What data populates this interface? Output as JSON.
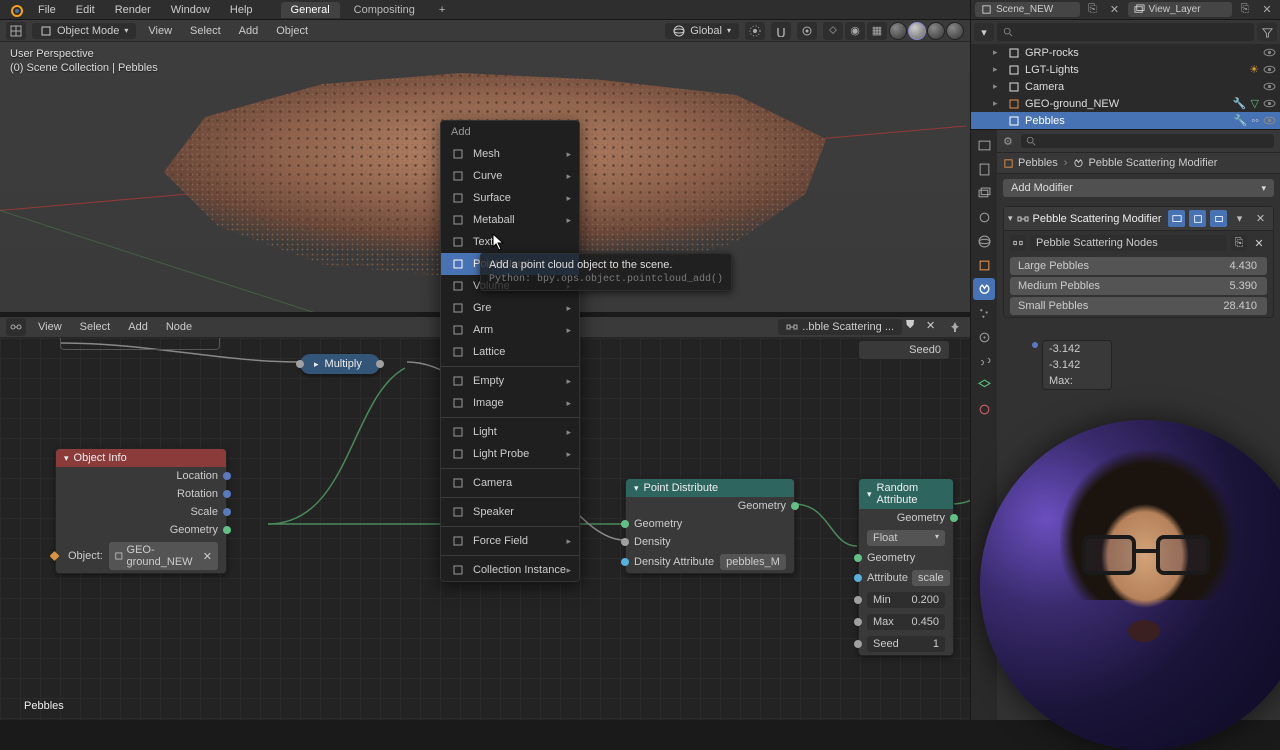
{
  "app": {
    "menus": [
      "File",
      "Edit",
      "Render",
      "Window",
      "Help"
    ],
    "tabs": {
      "general": "General",
      "compositing": "Compositing",
      "add": "+"
    },
    "scene_icon": "scene-icon",
    "scene": "Scene_NEW",
    "viewlayer_icon": "layer-icon",
    "viewlayer": "View_Layer"
  },
  "viewport_header": {
    "mode": "Object Mode",
    "menus": [
      "View",
      "Select",
      "Add",
      "Object"
    ],
    "orientation": "Global",
    "icon_dropdown": "chevron-down-icon"
  },
  "viewport": {
    "perspective": "User Perspective",
    "collection": "(0) Scene Collection | Pebbles",
    "active_object": "Pebbles"
  },
  "add_menu": {
    "title": "Add",
    "items": [
      {
        "icon": "mesh-icon",
        "label": "Mesh",
        "sub": true
      },
      {
        "icon": "curve-icon",
        "label": "Curve",
        "sub": true
      },
      {
        "icon": "surface-icon",
        "label": "Surface",
        "sub": true
      },
      {
        "icon": "metaball-icon",
        "label": "Metaball",
        "sub": true
      },
      {
        "icon": "text-icon",
        "label": "Text",
        "sub": false
      },
      {
        "icon": "pointcloud-icon",
        "label": "Point Cloud",
        "sub": false,
        "highlight": true
      },
      {
        "icon": "volume-icon",
        "label": "Volume",
        "sub": true
      },
      {
        "icon": "grease-pencil-icon",
        "label": "Gre",
        "sub": true,
        "cut": true
      },
      {
        "icon": "armature-icon",
        "label": "Arm",
        "sub": true,
        "cut": true
      },
      {
        "icon": "lattice-icon",
        "label": "Lattice",
        "sub": false
      },
      {
        "sep": true
      },
      {
        "icon": "empty-icon",
        "label": "Empty",
        "sub": true
      },
      {
        "icon": "image-icon",
        "label": "Image",
        "sub": true
      },
      {
        "sep": true
      },
      {
        "icon": "light-icon",
        "label": "Light",
        "sub": true
      },
      {
        "icon": "lightprobe-icon",
        "label": "Light Probe",
        "sub": true
      },
      {
        "sep": true
      },
      {
        "icon": "camera-icon",
        "label": "Camera",
        "sub": false
      },
      {
        "sep": true
      },
      {
        "icon": "speaker-icon",
        "label": "Speaker",
        "sub": false
      },
      {
        "sep": true
      },
      {
        "icon": "forcefield-icon",
        "label": "Force Field",
        "sub": true
      },
      {
        "sep": true
      },
      {
        "icon": "collection-icon",
        "label": "Collection Instance",
        "sub": true
      }
    ]
  },
  "tooltip": {
    "text": "Add a point cloud object to the scene.",
    "python": "Python: bpy.ops.object.pointcloud_add()"
  },
  "node_editor_header": {
    "menus": [
      "View",
      "Select",
      "Add",
      "Node"
    ],
    "nodegroup": "..bble Scattering ..."
  },
  "nodes": {
    "multiply": {
      "label": "Multiply"
    },
    "object_info": {
      "title": "Object Info",
      "out_location": "Location",
      "out_rotation": "Rotation",
      "out_scale": "Scale",
      "out_geometry": "Geometry",
      "object_label": "Object:",
      "object_value": "GEO-ground_NEW"
    },
    "point_distribute": {
      "title": "Point Distribute",
      "out_geometry": "Geometry",
      "in_geometry": "Geometry",
      "in_density": "Density",
      "in_density_attr": "Density Attribute",
      "density_attr_value": "pebbles_M"
    },
    "random_attribute": {
      "title": "Random Attribute",
      "out_geometry": "Geometry",
      "type": "Float",
      "in_geometry": "Geometry",
      "attribute_label": "Attribute",
      "attribute_value": "scale",
      "min_label": "Min",
      "min_value": "0.200",
      "max_label": "Max",
      "max_value": "0.450",
      "seed_label": "Seed",
      "seed_value": "1"
    },
    "seed_frag": {
      "label": "Seed",
      "value": "0"
    },
    "rot_frag": {
      "v1": "-3.142",
      "v2": "-3.142",
      "max": "Max:"
    },
    "side_frag": {
      "geom": "Geom",
      "obj": "Obje"
    },
    "po_pill": {
      "label": "Po"
    }
  },
  "outliner": {
    "search_placeholder": "",
    "items": [
      {
        "icon": "collection-icon",
        "label": "GRP-rocks",
        "color": "#ddd",
        "expand": true,
        "indent": 1
      },
      {
        "icon": "collection-icon",
        "label": "LGT-Lights",
        "color": "#ddd",
        "expand": true,
        "indent": 1,
        "extraicon": "light-icon"
      },
      {
        "icon": "camera-icon",
        "label": "Camera",
        "color": "#ddd",
        "expand": true,
        "indent": 1
      },
      {
        "icon": "mesh-icon",
        "label": "GEO-ground_NEW",
        "color": "#e09050",
        "expand": true,
        "indent": 1,
        "xtra": true
      },
      {
        "icon": "mesh-icon",
        "label": "Pebbles",
        "color": "#fff",
        "indent": 1,
        "selected": true,
        "xtra2": true
      }
    ]
  },
  "properties": {
    "search_placeholder": "",
    "breadcrumb": {
      "obj": "Pebbles",
      "mod": "Pebble Scattering Modifier"
    },
    "add_modifier": "Add Modifier",
    "modifier": {
      "name": "Pebble Scattering Modifier",
      "nodegroup": "Pebble Scattering Nodes",
      "props": [
        {
          "k": "Large Pebbles",
          "v": "4.430"
        },
        {
          "k": "Medium Pebbles",
          "v": "5.390"
        },
        {
          "k": "Small Pebbles",
          "v": "28.410"
        }
      ]
    }
  }
}
